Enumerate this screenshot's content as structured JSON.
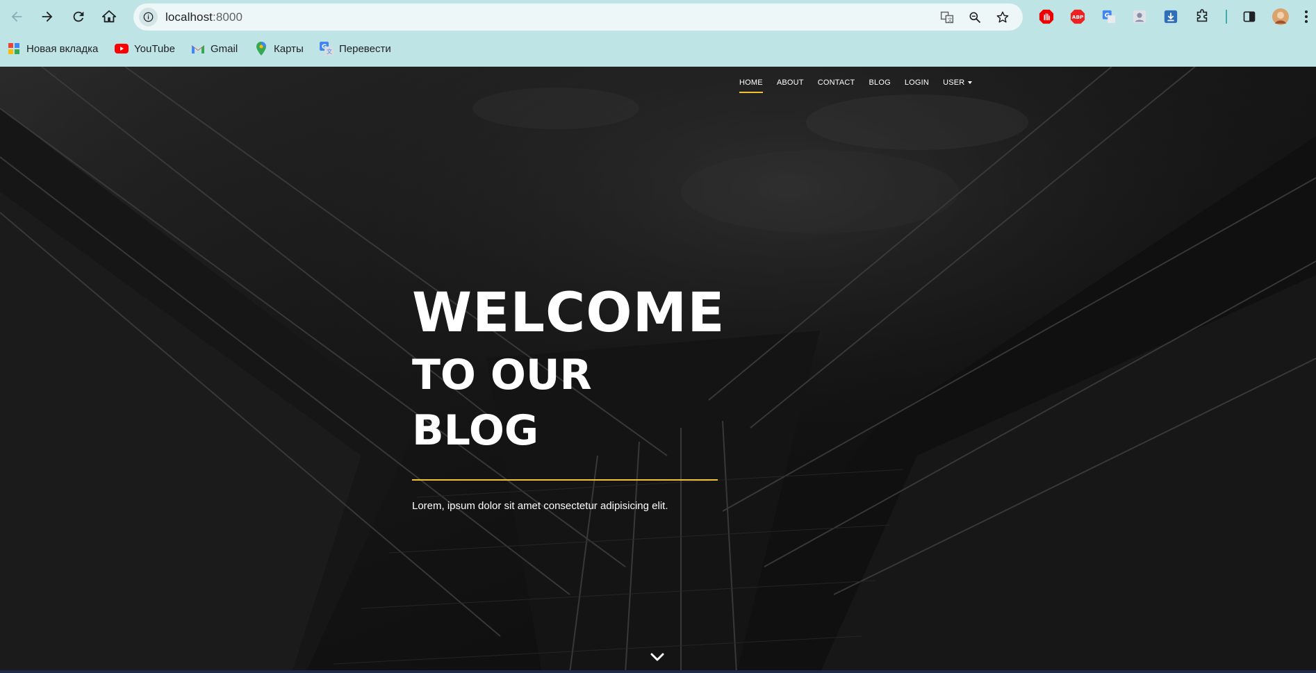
{
  "browser": {
    "url_host": "localhost",
    "url_port": ":8000",
    "bookmarks": [
      {
        "label": "Новая вкладка",
        "icon": "apps-grid-icon"
      },
      {
        "label": "YouTube",
        "icon": "youtube-icon"
      },
      {
        "label": "Gmail",
        "icon": "gmail-icon"
      },
      {
        "label": "Карты",
        "icon": "maps-pin-icon"
      },
      {
        "label": "Перевести",
        "icon": "translate-icon"
      }
    ]
  },
  "site": {
    "nav": [
      {
        "label": "HOME",
        "active": true
      },
      {
        "label": "ABOUT"
      },
      {
        "label": "CONTACT"
      },
      {
        "label": "BLOG"
      },
      {
        "label": "LOGIN"
      },
      {
        "label": "USER",
        "dropdown": true
      }
    ],
    "hero": {
      "title": "WELCOME",
      "subtitle": "TO OUR BLOG",
      "text": "Lorem, ipsum dolor sit amet consectetur adipisicing elit."
    }
  },
  "colors": {
    "accent": "#f1c232",
    "chrome": "#bfe4e6"
  }
}
